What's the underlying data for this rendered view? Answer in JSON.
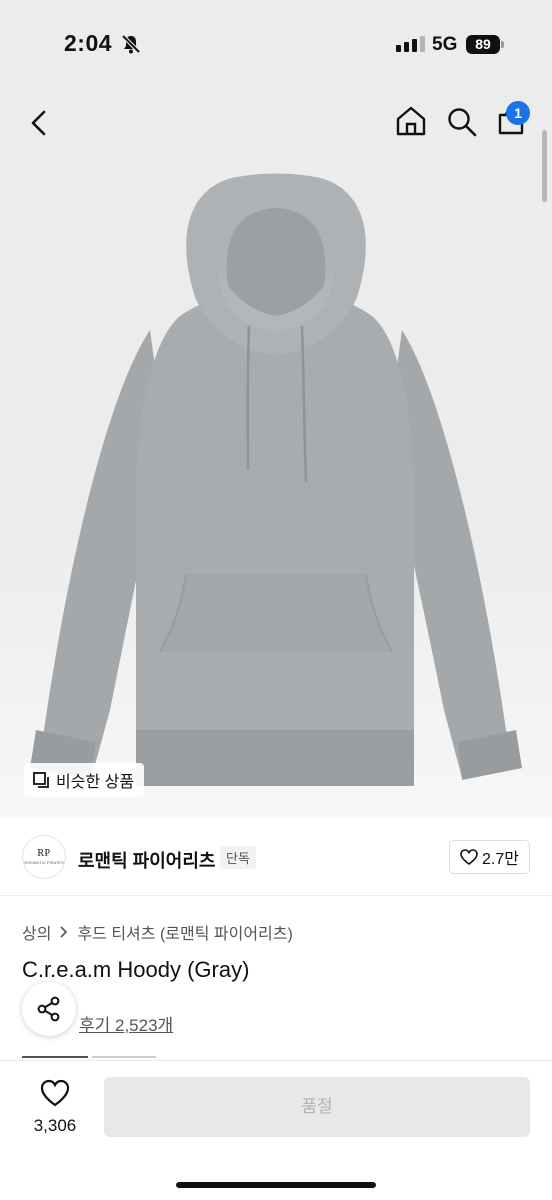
{
  "status_bar": {
    "time": "2:04",
    "network": "5G",
    "battery": "89"
  },
  "nav": {
    "cart_count": "1"
  },
  "hero": {
    "similar_label": "비슷한 상품",
    "image_alt": "gray hoodie"
  },
  "brand": {
    "logo_text": "RP",
    "logo_sub": "ROMANTIC PIRATES",
    "name": "로맨틱 파이어리츠",
    "badge": "단독",
    "likes": "2.7만"
  },
  "product": {
    "category": "상의",
    "subcategory": "후드 티셔츠 (로맨틱 파이어리츠)",
    "title": "C.r.e.a.m Hoody (Gray)",
    "reviews": "후기 2,523개"
  },
  "bottom_bar": {
    "wish_count": "3,306",
    "buy_label": "품절"
  },
  "colors": {
    "accent": "#1a73e8",
    "hoodie": "#a6aaad"
  }
}
